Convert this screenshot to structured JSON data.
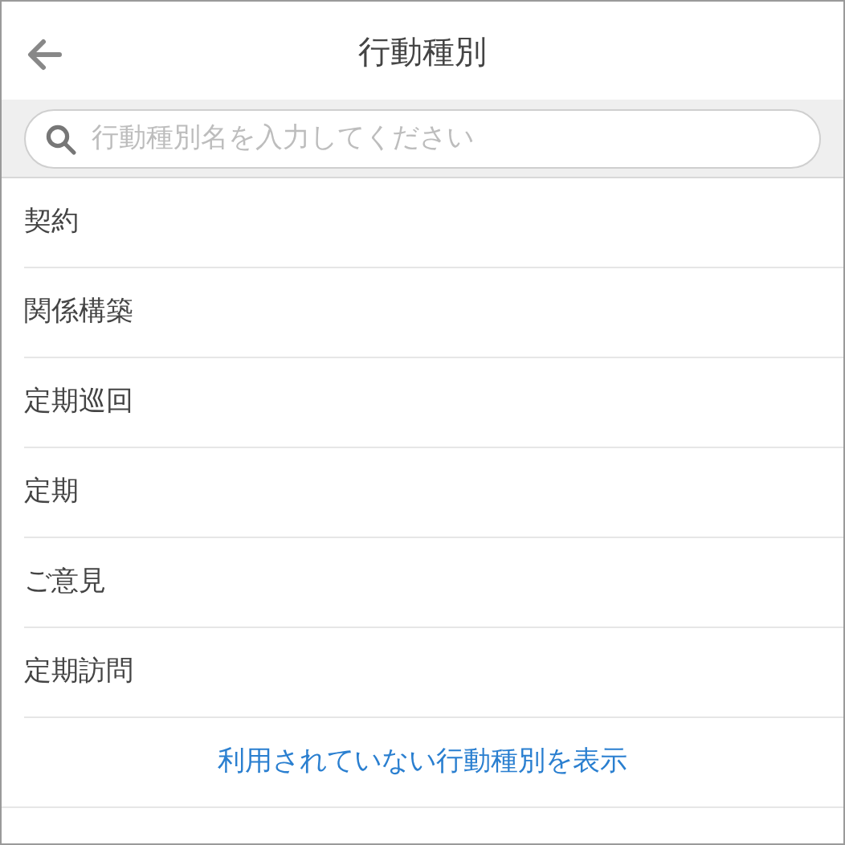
{
  "header": {
    "title": "行動種別"
  },
  "search": {
    "placeholder": "行動種別名を入力してください"
  },
  "items": [
    {
      "label": "契約"
    },
    {
      "label": "関係構築"
    },
    {
      "label": "定期巡回"
    },
    {
      "label": "定期"
    },
    {
      "label": "ご意見"
    },
    {
      "label": "定期訪問"
    }
  ],
  "show_unused_link": "利用されていない行動種別を表示"
}
